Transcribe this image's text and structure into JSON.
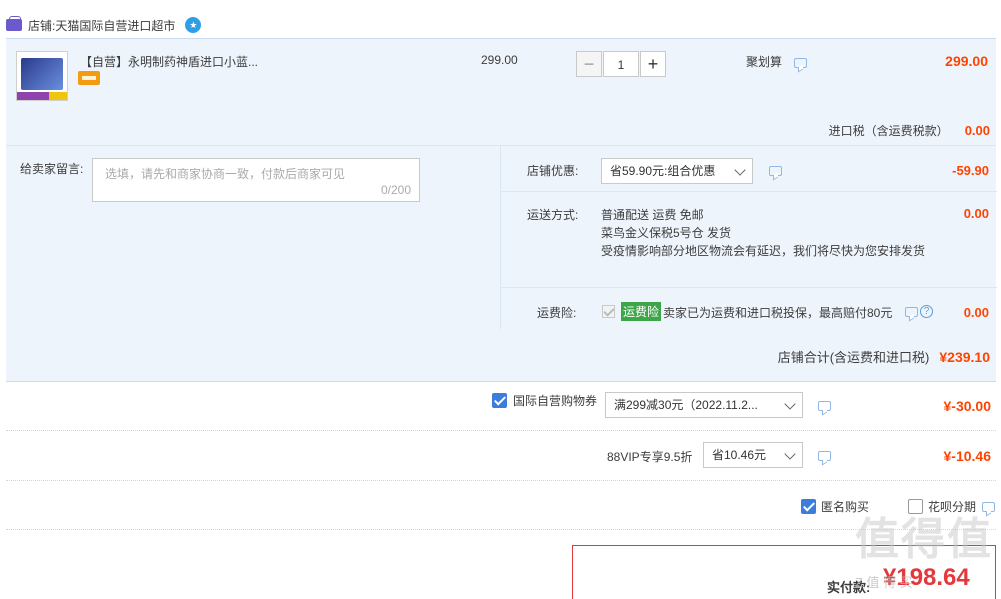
{
  "shop": {
    "label": "店铺:",
    "name": "天猫国际自营进口超市"
  },
  "item": {
    "title": "【自营】永明制药神盾进口小蓝...",
    "unit_price": "299.00",
    "quantity": "1",
    "minus": "−",
    "plus": "+",
    "promo": "聚划算",
    "total": "299.00"
  },
  "tax": {
    "label": "进口税（含运费税款）",
    "value": "0.00"
  },
  "note": {
    "label": "给卖家留言:",
    "placeholder": "选填，请先和商家协商一致，付款后商家可见",
    "count": "0/200"
  },
  "shop_discount": {
    "label": "店铺优惠:",
    "selected": "省59.90元:组合优惠",
    "value": "-59.90"
  },
  "shipping": {
    "label": "运送方式:",
    "line1": "普通配送 运费 免邮",
    "line2": "菜鸟金义保税5号仓  发货",
    "line3": "受疫情影响部分地区物流会有延迟，我们将尽快为您安排发货",
    "value": "0.00"
  },
  "insurance": {
    "label": "运费险:",
    "tag": "运费险",
    "text": "卖家已为运费和进口税投保，最高赔付80元",
    "value": "0.00"
  },
  "subtotal": {
    "label": "店铺合计(含运费和进口税)",
    "value": "¥239.10"
  },
  "coupon": {
    "label": "国际自营购物券",
    "selected": "满299减30元（2022.11.2...",
    "value": "¥-30.00"
  },
  "vip": {
    "label": "88VIP专享9.5折",
    "selected": "省10.46元",
    "value": "¥-10.46"
  },
  "options": {
    "anonymous": "匿名购买",
    "huabei": "花呗分期"
  },
  "payment": {
    "label": "实付款:",
    "value": "¥198.64"
  },
  "watermark": {
    "main": "值得值",
    "sub": "Z 值 得 买"
  }
}
